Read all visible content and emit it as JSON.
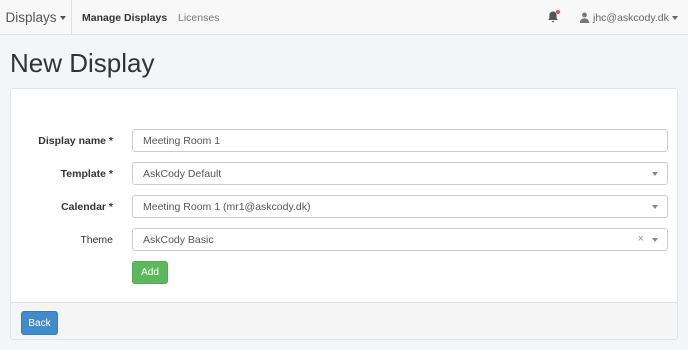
{
  "navbar": {
    "brand": "Displays",
    "links": [
      "Manage Displays",
      "Licenses"
    ],
    "user": "jhc@askcody.dk",
    "notification_dot_color": "#d9534f"
  },
  "page_title": "New Display",
  "form": {
    "display_name": {
      "label": "Display name *",
      "value": "Meeting Room 1"
    },
    "template": {
      "label": "Template *",
      "value": "AskCody Default"
    },
    "calendar": {
      "label": "Calendar *",
      "value": "Meeting Room 1 (mr1@askcody.dk)"
    },
    "theme": {
      "label": "Theme",
      "value": "AskCody Basic",
      "clear": "×"
    },
    "add_button": "Add"
  },
  "footer": {
    "back_button": "Back"
  },
  "colors": {
    "add_button": "#5cb85c",
    "back_button": "#428bca"
  }
}
